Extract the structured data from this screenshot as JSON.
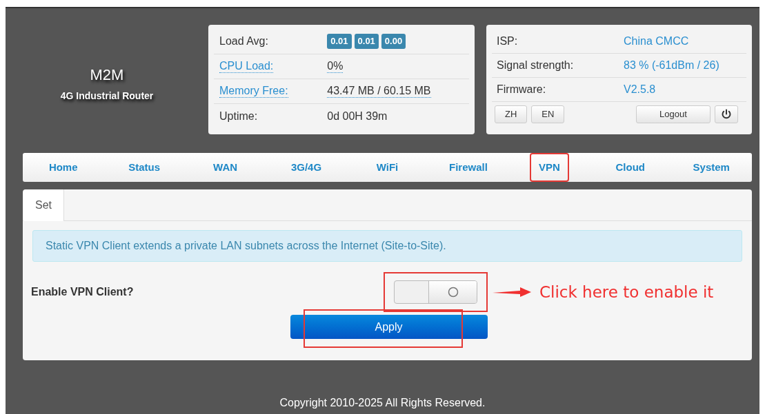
{
  "brand": {
    "title": "M2M",
    "subtitle": "4G Industrial Router"
  },
  "system_info": [
    {
      "label": "Load Avg:",
      "kind": "badges",
      "link": false,
      "values": [
        "0.01",
        "0.01",
        "0.00"
      ]
    },
    {
      "label": "CPU Load:",
      "kind": "text",
      "link": true,
      "values": [
        "0%"
      ]
    },
    {
      "label": "Memory Free:",
      "kind": "text",
      "link": true,
      "values": [
        "43.47 MB / 60.15 MB"
      ]
    },
    {
      "label": "Uptime:",
      "kind": "text",
      "link": false,
      "values": [
        "0d 00H 39m"
      ]
    }
  ],
  "network_info": [
    {
      "label": "ISP:",
      "value": "China CMCC"
    },
    {
      "label": "Signal strength:",
      "value": "83 % (-61dBm / 26)"
    },
    {
      "label": "Firmware:",
      "value": "V2.5.8"
    }
  ],
  "language_buttons": [
    "ZH",
    "EN"
  ],
  "logout_button": "Logout",
  "nav": [
    {
      "label": "Home",
      "annotated": false
    },
    {
      "label": "Status",
      "annotated": false
    },
    {
      "label": "WAN",
      "annotated": false
    },
    {
      "label": "3G/4G",
      "annotated": false
    },
    {
      "label": "WiFi",
      "annotated": false
    },
    {
      "label": "Firewall",
      "annotated": false
    },
    {
      "label": "VPN",
      "annotated": true
    },
    {
      "label": "Cloud",
      "annotated": false
    },
    {
      "label": "System",
      "annotated": false
    }
  ],
  "tabs": [
    {
      "label": "Set",
      "selected": true
    }
  ],
  "info_message": "Static VPN Client extends a private LAN subnets across the Internet (Site-to-Site).",
  "setting": {
    "label": "Enable VPN Client?",
    "on": false
  },
  "apply_button": "Apply",
  "annotation": "Click here to enable it",
  "footer": "Copyright 2010-2025 All Rights Reserved."
}
